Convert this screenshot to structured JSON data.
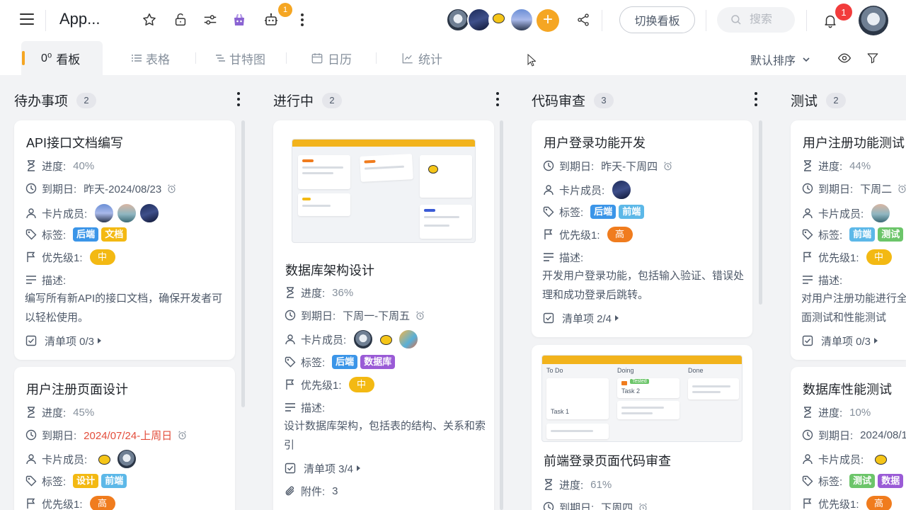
{
  "app": {
    "title": "App..."
  },
  "header": {
    "switch_board_label": "切换看板",
    "search_placeholder": "搜索",
    "robot_badge": "1",
    "notification_badge": "1",
    "add_member_label": "+"
  },
  "tabs": [
    {
      "label": "看板",
      "icon": "kanban-icon"
    },
    {
      "label": "表格",
      "icon": "table-icon"
    },
    {
      "label": "甘特图",
      "icon": "gantt-icon"
    },
    {
      "label": "日历",
      "icon": "calendar-icon"
    },
    {
      "label": "统计",
      "icon": "chart-icon"
    }
  ],
  "sort": {
    "label": "默认排序"
  },
  "columns": [
    {
      "title": "待办事项",
      "count": "2",
      "cards": [
        {
          "title": "API接口文档编写",
          "progress": "40%",
          "due": "昨天-2024/08/23",
          "tags": [
            "后端",
            "文档"
          ],
          "priority": "中",
          "description": "编写所有新API的接口文档，确保开发者可以轻松使用。",
          "checklist": "清单项 0/3"
        },
        {
          "title": "用户注册页面设计",
          "progress": "45%",
          "due": "2024/07/24-上周日",
          "tags": [
            "设计",
            "前端"
          ],
          "priority": "高"
        }
      ]
    },
    {
      "title": "进行中",
      "count": "2",
      "cards": [
        {
          "title": "数据库架构设计",
          "progress": "36%",
          "due": "下周一-下周五",
          "tags": [
            "后端",
            "数据库"
          ],
          "priority": "中",
          "description": "设计数据库架构，包括表的结构、关系和索引",
          "checklist": "清单项 3/4",
          "attachments": "3"
        }
      ]
    },
    {
      "title": "代码审查",
      "count": "3",
      "cards": [
        {
          "title": "用户登录功能开发",
          "due": "昨天-下周四",
          "tags": [
            "后端",
            "前端"
          ],
          "priority": "高",
          "description": "开发用户登录功能，包括输入验证、错误处理和成功登录后跳转。",
          "checklist": "清单项 2/4"
        },
        {
          "title": "前端登录页面代码审查",
          "progress": "61%",
          "due": "下周四",
          "thumb_columns": [
            "To Do",
            "Doing",
            "Done"
          ],
          "thumb_tasks": [
            "Task 1",
            "Task 2"
          ],
          "thumb_label": "Tested"
        }
      ]
    },
    {
      "title": "测试",
      "count": "2",
      "cards": [
        {
          "title": "用户注册功能测试",
          "progress": "44%",
          "due": "下周二",
          "tags": [
            "前端",
            "测试"
          ],
          "priority": "中",
          "description": "对用户注册功能进行全面测试和性能测试",
          "checklist": "清单项 0/3"
        },
        {
          "title": "数据库性能测试",
          "progress": "10%",
          "due": "2024/08/1",
          "tags": [
            "测试",
            "数据"
          ],
          "priority": "高"
        }
      ]
    }
  ],
  "labels": {
    "progress": "进度:",
    "due": "到期日:",
    "members": "卡片成员:",
    "tags": "标签:",
    "priority": "优先级1:",
    "description": "描述:",
    "attachments": "附件:"
  },
  "colors": {
    "accent": "#f5a623",
    "tag_blue": "#3b95e8",
    "tag_yellow": "#f3b913",
    "tag_purple": "#9a5bd6",
    "tag_green": "#6cc56a",
    "priority_high": "#f07c1e",
    "overdue_red": "#e34d3b"
  }
}
